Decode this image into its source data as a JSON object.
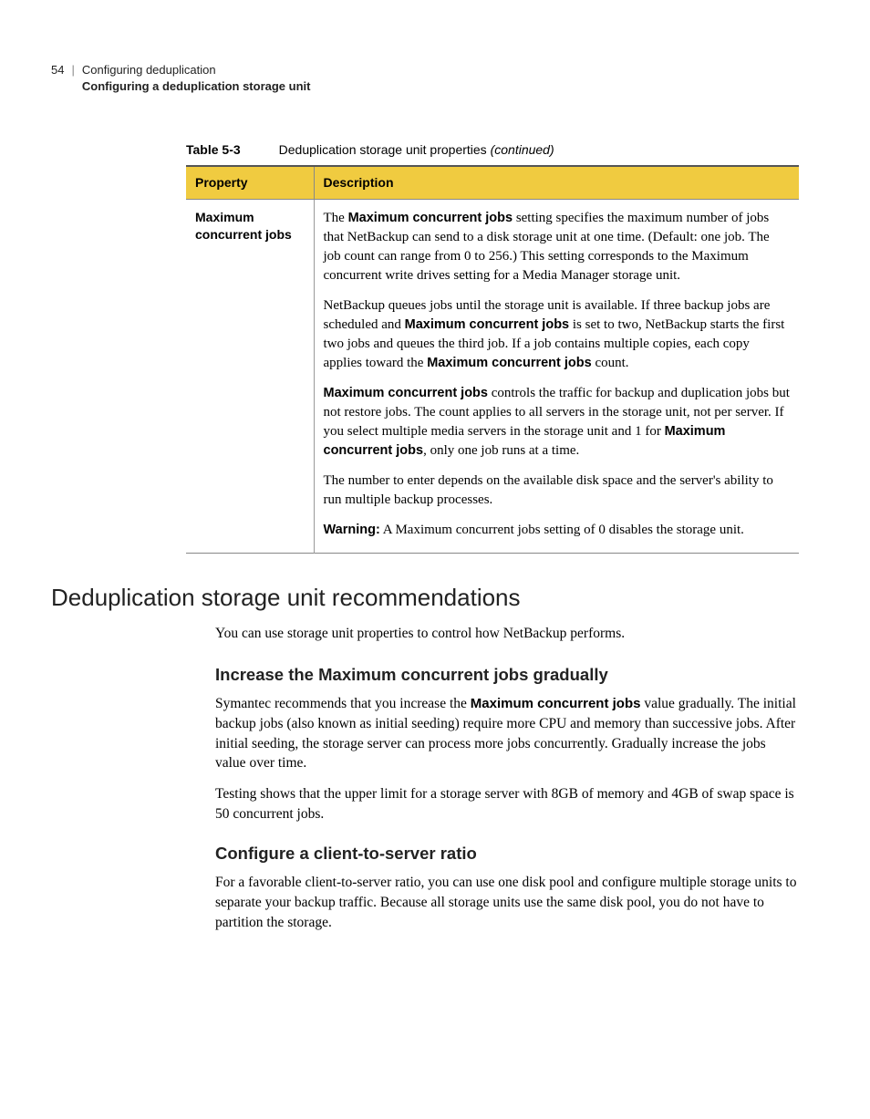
{
  "header": {
    "page_number": "54",
    "chapter": "Configuring deduplication",
    "section": "Configuring a deduplication storage unit"
  },
  "table": {
    "label": "Table 5-3",
    "caption_text": "Deduplication storage unit properties ",
    "caption_em": "(continued)",
    "col1": "Property",
    "col2": "Description",
    "row": {
      "property": "Maximum concurrent jobs",
      "p1_a": "The ",
      "p1_b": "Maximum concurrent jobs",
      "p1_c": " setting specifies the maximum number of jobs that NetBackup can send to a disk storage unit at one time. (Default: one job. The job count can range from 0 to 256.) This setting corresponds to the Maximum concurrent write drives setting for a Media Manager storage unit.",
      "p2_a": "NetBackup queues jobs until the storage unit is available. If three backup jobs are scheduled and ",
      "p2_b": "Maximum concurrent jobs",
      "p2_c": " is set to two, NetBackup starts the first two jobs and queues the third job. If a job contains multiple copies, each copy applies toward the ",
      "p2_d": "Maximum concurrent jobs",
      "p2_e": " count.",
      "p3_a": "Maximum concurrent jobs",
      "p3_b": " controls the traffic for backup and duplication jobs but not restore jobs. The count applies to all servers in the storage unit, not per server. If you select multiple media servers in the storage unit and 1 for ",
      "p3_c": "Maximum concurrent jobs",
      "p3_d": ", only one job runs at a time.",
      "p4": "The number to enter depends on the available disk space and the server's ability to run multiple backup processes.",
      "p5_a": "Warning:",
      "p5_b": " A Maximum concurrent jobs setting of 0 disables the storage unit."
    }
  },
  "h1": "Deduplication storage unit recommendations",
  "intro": "You can use storage unit properties to control how NetBackup performs.",
  "sec1": {
    "heading": "Increase the Maximum concurrent jobs gradually",
    "p1_a": "Symantec recommends that you increase the ",
    "p1_b": "Maximum concurrent jobs",
    "p1_c": " value gradually. The initial backup jobs (also known as initial seeding) require more CPU and memory than successive jobs. After initial seeding, the storage server can process more jobs concurrently. Gradually increase the jobs value over time.",
    "p2": "Testing shows that the upper limit for a storage server with 8GB of memory and 4GB of swap space is 50 concurrent jobs."
  },
  "sec2": {
    "heading": "Configure a client-to-server ratio",
    "p1": "For a favorable client-to-server ratio, you can use one disk pool and configure multiple storage units to separate your backup traffic. Because all storage units use the same disk pool, you do not have to partition the storage."
  }
}
